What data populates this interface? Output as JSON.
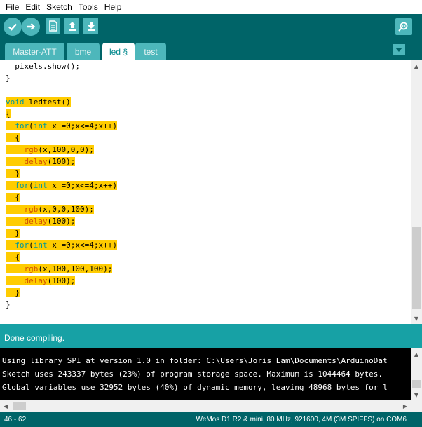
{
  "menu": [
    {
      "underline": "F",
      "rest": "ile"
    },
    {
      "underline": "E",
      "rest": "dit"
    },
    {
      "underline": "S",
      "rest": "ketch"
    },
    {
      "underline": "T",
      "rest": "ools"
    },
    {
      "underline": "H",
      "rest": "elp"
    }
  ],
  "toolbar": {
    "icons": [
      "verify-icon",
      "upload-icon",
      "new-icon",
      "open-icon",
      "save-icon",
      "serial-monitor-icon"
    ]
  },
  "tabs": [
    {
      "label": "Master-ATT",
      "active": false
    },
    {
      "label": "bme",
      "active": false
    },
    {
      "label": "led §",
      "active": true
    },
    {
      "label": "test",
      "active": false
    }
  ],
  "code": {
    "lines": [
      {
        "text": "  pixels.show();",
        "hl": false
      },
      {
        "text": "}",
        "hl": false
      },
      {
        "text": "",
        "hl": false
      },
      {
        "text": "void ledtest()",
        "hl": true
      },
      {
        "text": "{",
        "hl": true
      },
      {
        "text": "  for(int x =0;x<=4;x++)",
        "hl": true
      },
      {
        "text": "  {",
        "hl": true
      },
      {
        "text": "    rgb(x,100,0,0);",
        "hl": true
      },
      {
        "text": "    delay(100);",
        "hl": true
      },
      {
        "text": "  }",
        "hl": true
      },
      {
        "text": "  for(int x =0;x<=4;x++)",
        "hl": true
      },
      {
        "text": "  {",
        "hl": true
      },
      {
        "text": "    rgb(x,0,0,100);",
        "hl": true
      },
      {
        "text": "    delay(100);",
        "hl": true
      },
      {
        "text": "  }",
        "hl": true
      },
      {
        "text": "  for(int x =0;x<=4;x++)",
        "hl": true
      },
      {
        "text": "  {",
        "hl": true
      },
      {
        "text": "    rgb(x,100,100,100);",
        "hl": true
      },
      {
        "text": "    delay(100);",
        "hl": true
      },
      {
        "text": "  }",
        "hl": true,
        "caret": true
      },
      {
        "text": "}",
        "hl": false
      }
    ]
  },
  "status": {
    "text": "Done compiling."
  },
  "console": {
    "lines": [
      "Using library SPI at version 1.0 in folder: C:\\Users\\Joris Lam\\Documents\\ArduinoDat",
      "Sketch uses 243337 bytes (23%) of program storage space. Maximum is 1044464 bytes.",
      "Global variables use 32952 bytes (40%) of dynamic memory, leaving 48968 bytes for l"
    ]
  },
  "footer": {
    "position": "46 - 62",
    "board": "WeMos D1 R2 & mini, 80 MHz, 921600, 4M (3M SPIFFS) on COM6"
  },
  "colors": {
    "toolbar": "#006468",
    "button": "#4db7bb",
    "status": "#17a1a5",
    "highlight": "#ffcc00",
    "keyword_type": "#00979c",
    "keyword_function": "#d35400"
  }
}
